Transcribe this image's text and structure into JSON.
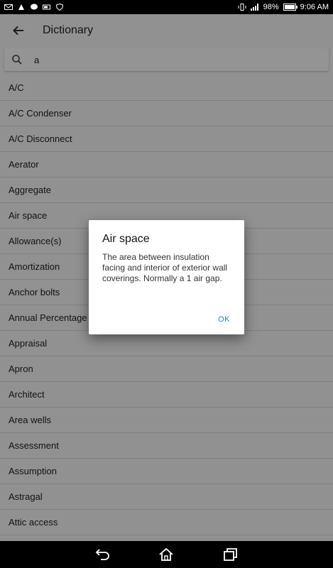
{
  "status_bar": {
    "battery": "98%",
    "battery_level": 0.98,
    "time": "9:06 AM",
    "left_icons": [
      "mail-icon",
      "cleaner-icon",
      "chat-icon",
      "battery-saver-icon",
      "shield-icon"
    ],
    "right_icons": [
      "vibrate-icon",
      "signal-icon"
    ]
  },
  "toolbar": {
    "title": "Dictionary"
  },
  "search": {
    "value": "a"
  },
  "list": {
    "items": [
      "A/C",
      "A/C Condenser",
      "A/C Disconnect",
      "Aerator",
      "Aggregate",
      "Air space",
      "Allowance(s)",
      "Amortization",
      "Anchor bolts",
      "Annual Percentage R",
      "Appraisal",
      "Apron",
      "Architect",
      "Area wells",
      "Assessment",
      "Assumption",
      "Astragal",
      "Attic access"
    ]
  },
  "dialog": {
    "title": "Air space",
    "body": "The area between insulation facing and interior of exterior wall coverings. Normally a 1 air gap.",
    "ok_label": "OK"
  },
  "colors": {
    "accent": "#2a7bd4",
    "scrim": "#000000"
  }
}
